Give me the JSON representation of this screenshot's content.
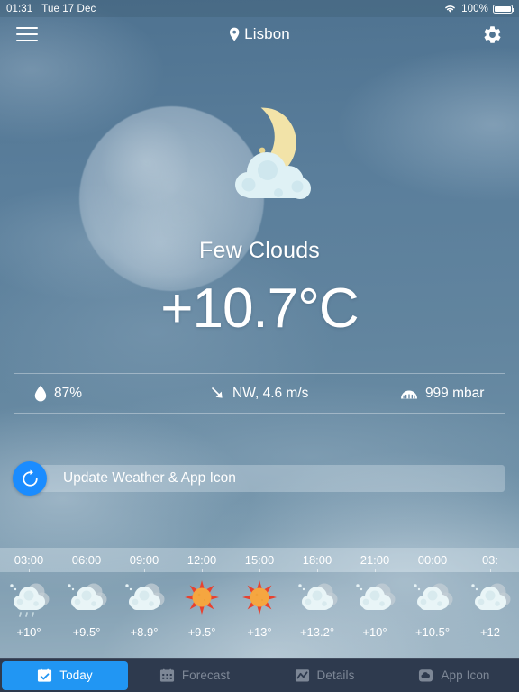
{
  "statusbar": {
    "time": "01:31",
    "date": "Tue 17 Dec",
    "battery_percent": "100%",
    "wifi_icon": "wifi-icon",
    "battery_icon": "battery-icon"
  },
  "navbar": {
    "menu_icon": "hamburger-menu-icon",
    "location_icon": "location-pin-icon",
    "location": "Lisbon",
    "settings_icon": "gear-icon"
  },
  "current": {
    "weather_icon": "moon-behind-cloud-icon",
    "condition": "Few Clouds",
    "temperature": "+10.7°C"
  },
  "metrics": [
    {
      "icon": "humidity-droplet-icon",
      "value": "87%",
      "name": "humidity"
    },
    {
      "icon": "wind-arrow-southeast-icon",
      "value": "NW, 4.6 m/s",
      "name": "wind"
    },
    {
      "icon": "pressure-gauge-icon",
      "value": "999 mbar",
      "name": "pressure"
    }
  ],
  "update": {
    "icon": "refresh-icon",
    "label": "Update Weather & App Icon"
  },
  "hourly": {
    "times": [
      "03:00",
      "06:00",
      "09:00",
      "12:00",
      "15:00",
      "18:00",
      "21:00",
      "00:00",
      "03:"
    ],
    "entries": [
      {
        "time": "03:00",
        "icon": "rain-cloud-icon",
        "temp": "+10°"
      },
      {
        "time": "06:00",
        "icon": "cloud-icon",
        "temp": "+9.5°"
      },
      {
        "time": "09:00",
        "icon": "cloud-icon",
        "temp": "+8.9°"
      },
      {
        "time": "12:00",
        "icon": "sun-icon",
        "temp": "+9.5°"
      },
      {
        "time": "15:00",
        "icon": "sun-icon",
        "temp": "+13°"
      },
      {
        "time": "18:00",
        "icon": "cloud-icon",
        "temp": "+13.2°"
      },
      {
        "time": "21:00",
        "icon": "cloud-icon",
        "temp": "+10°"
      },
      {
        "time": "00:00",
        "icon": "cloud-icon",
        "temp": "+10.5°"
      },
      {
        "time": "03:",
        "icon": "cloud-icon",
        "temp": "+12"
      }
    ]
  },
  "tabs": [
    {
      "label": "Today",
      "icon": "calendar-check-icon",
      "active": true
    },
    {
      "label": "Forecast",
      "icon": "calendar-grid-icon",
      "active": false
    },
    {
      "label": "Details",
      "icon": "chart-line-icon",
      "active": false
    },
    {
      "label": "App Icon",
      "icon": "cloud-app-icon",
      "active": false
    }
  ],
  "colors": {
    "accent_blue": "#2196f3",
    "update_blue": "#1a8cff",
    "tabbar_bg": "#2e3a4e",
    "sky": "#5b7e9c",
    "sun_core": "#f5a640",
    "sun_rays": "#e8412f",
    "moon_yellow": "#f2e3a8"
  }
}
